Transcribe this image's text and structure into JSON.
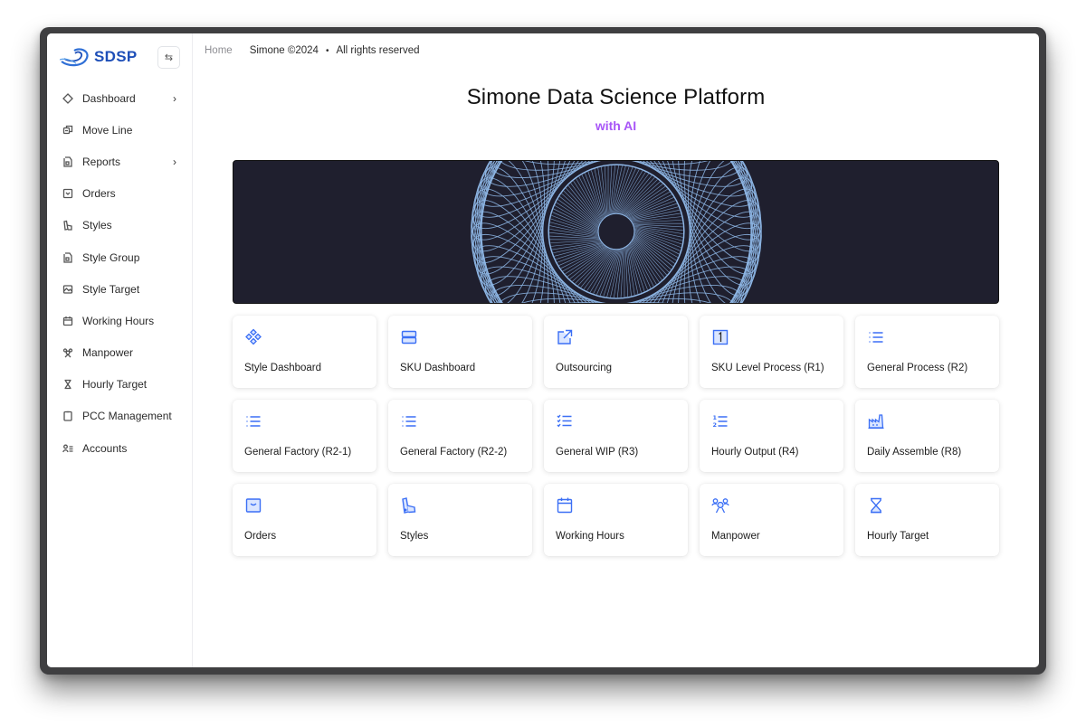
{
  "brand": {
    "name": "SDSP",
    "logo_icon": "swirl-logo-icon",
    "color": "#1e4fb8"
  },
  "sidebar": {
    "collapse_icon": "swap-arrows-icon",
    "items": [
      {
        "label": "Dashboard",
        "icon": "diamond-icon",
        "has_submenu": true
      },
      {
        "label": "Move Line",
        "icon": "move-icon",
        "has_submenu": false
      },
      {
        "label": "Reports",
        "icon": "report-file-icon",
        "has_submenu": true
      },
      {
        "label": "Orders",
        "icon": "inbox-icon",
        "has_submenu": false
      },
      {
        "label": "Styles",
        "icon": "swatch-icon",
        "has_submenu": false
      },
      {
        "label": "Style Group",
        "icon": "file-group-icon",
        "has_submenu": false
      },
      {
        "label": "Style Target",
        "icon": "image-icon",
        "has_submenu": false
      },
      {
        "label": "Working Hours",
        "icon": "calendar-icon",
        "has_submenu": false
      },
      {
        "label": "Manpower",
        "icon": "people-icon",
        "has_submenu": false
      },
      {
        "label": "Hourly Target",
        "icon": "hourglass-icon",
        "has_submenu": false
      },
      {
        "label": "PCC Management",
        "icon": "clipboard-icon",
        "has_submenu": false
      },
      {
        "label": "Accounts",
        "icon": "user-list-icon",
        "has_submenu": false
      }
    ],
    "chevron": "›"
  },
  "breadcrumb": {
    "home": "Home",
    "copyright": "Simone ©2024",
    "separator": "•",
    "rights": "All rights reserved"
  },
  "header": {
    "title": "Simone Data Science Platform",
    "subtitle": "with AI",
    "subtitle_color": "#a855f7"
  },
  "banner": {
    "background": "#1f1f2e",
    "line_color": "#8fb8e8",
    "icon": "spirograph-art"
  },
  "accent_color": "#3b6ff5",
  "cards": [
    {
      "label": "Style Dashboard",
      "icon": "diamond-grid-icon"
    },
    {
      "label": "SKU Dashboard",
      "icon": "stacked-rows-icon"
    },
    {
      "label": "Outsourcing",
      "icon": "external-link-icon"
    },
    {
      "label": "SKU Level Process (R1)",
      "icon": "number-one-box-icon"
    },
    {
      "label": "General Process (R2)",
      "icon": "list-icon"
    },
    {
      "label": "General Factory (R2-1)",
      "icon": "list-icon"
    },
    {
      "label": "General Factory (R2-2)",
      "icon": "list-icon"
    },
    {
      "label": "General WIP (R3)",
      "icon": "checklist-icon"
    },
    {
      "label": "Hourly Output (R4)",
      "icon": "numbered-list-icon"
    },
    {
      "label": "Daily Assemble (R8)",
      "icon": "factory-icon"
    },
    {
      "label": "Orders",
      "icon": "inbox-icon"
    },
    {
      "label": "Styles",
      "icon": "swatch-icon"
    },
    {
      "label": "Working Hours",
      "icon": "calendar-icon"
    },
    {
      "label": "Manpower",
      "icon": "people-icon"
    },
    {
      "label": "Hourly Target",
      "icon": "hourglass-icon"
    }
  ]
}
